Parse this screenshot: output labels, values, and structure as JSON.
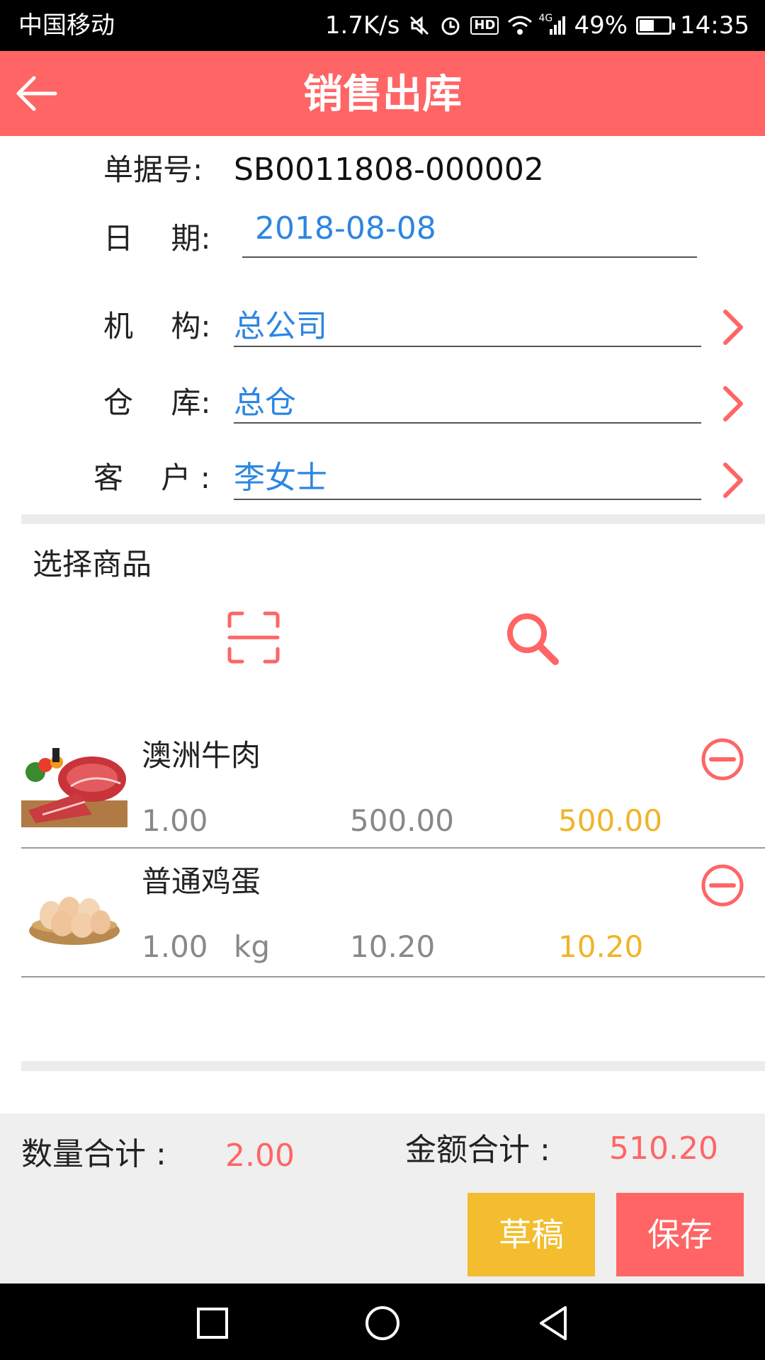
{
  "status_bar": {
    "carrier": "中国移动",
    "speed": "1.7K/s",
    "hd": "HD",
    "network": "4G",
    "battery": "49%",
    "battery_level": 0.49,
    "time": "14:35",
    "icons": [
      "mute-icon",
      "alarm-icon",
      "wifi-icon",
      "signal-icon",
      "battery-icon"
    ]
  },
  "header": {
    "title": "销售出库",
    "back_icon": "arrow-left-icon"
  },
  "form": {
    "doc_no_label": "单据号:",
    "doc_no": "SB0011808-000002",
    "date_label": "日    期:",
    "date": "2018-08-08",
    "org_label": "机    构:",
    "org": "总公司",
    "warehouse_label": "仓    库:",
    "warehouse": "总仓",
    "customer_label": "客    户 :",
    "customer": "李女士"
  },
  "goods": {
    "title": "选择商品",
    "scan_icon": "scan-icon",
    "search_icon": "search-icon",
    "items": [
      {
        "name": "澳洲牛肉",
        "qty": "1.00",
        "unit": "",
        "price": "500.00",
        "amount": "500.00",
        "image": "beef-image"
      },
      {
        "name": "普通鸡蛋",
        "qty": "1.00",
        "unit": "kg",
        "price": "10.20",
        "amount": "10.20",
        "image": "eggs-image"
      }
    ]
  },
  "footer": {
    "qty_total_label": "数量合计 :",
    "qty_total": "2.00",
    "amount_total_label": "金额合计 :",
    "amount_total": "510.20",
    "draft_button": "草稿",
    "save_button": "保存"
  },
  "colors": {
    "brand": "#ff6565",
    "link_blue": "#2d86e0",
    "amount_yellow": "#f0b429",
    "draft_yellow": "#f3bd2f"
  }
}
